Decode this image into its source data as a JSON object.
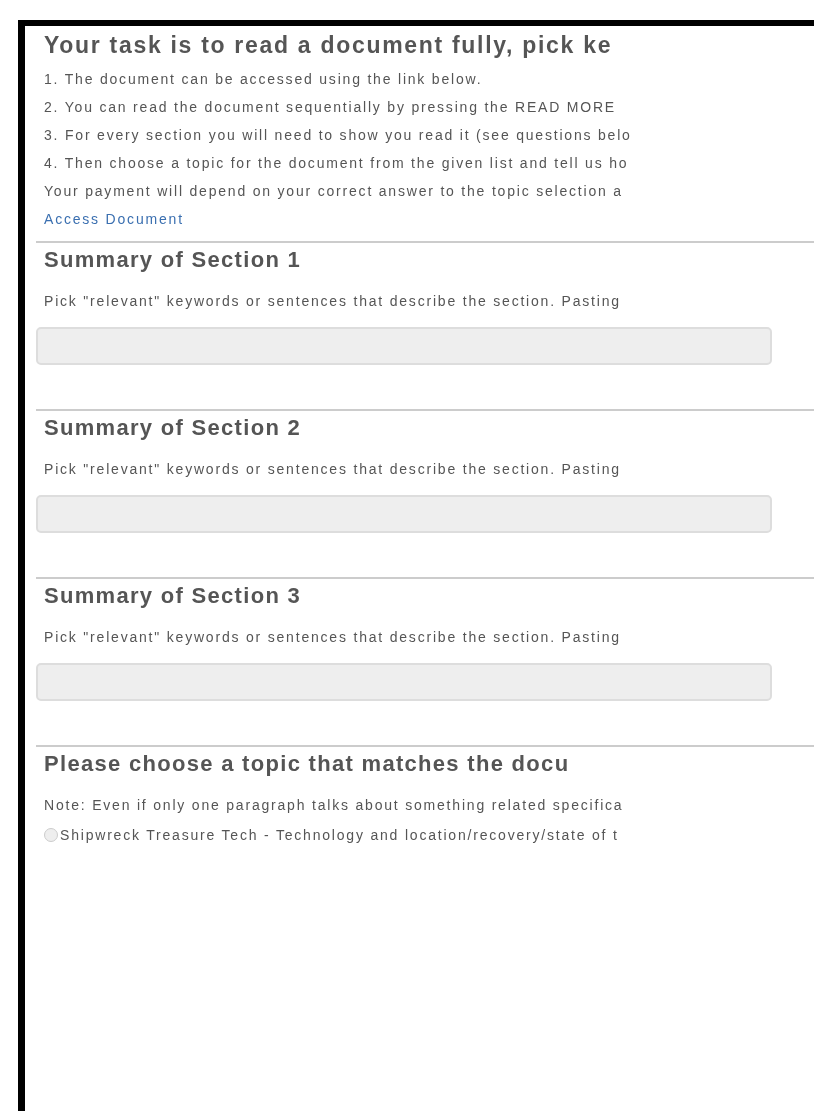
{
  "title": "Your task is to read a document fully, pick ke",
  "instructions": [
    "1. The document can be accessed using the link below.",
    "2. You can read the document sequentially by pressing the READ MORE",
    "3. For every section you will need to show you read it (see questions belo",
    "4. Then choose a topic for the document from the given list and tell us ho"
  ],
  "payment_note": "Your payment will depend on your correct answer to the topic selection a",
  "document_link": "Access Document",
  "sections": [
    {
      "heading": "Summary of Section 1",
      "description": "Pick \"relevant\" keywords or sentences that describe the section. Pasting"
    },
    {
      "heading": "Summary of Section 2",
      "description": "Pick \"relevant\" keywords or sentences that describe the section. Pasting"
    },
    {
      "heading": "Summary of Section 3",
      "description": "Pick \"relevant\" keywords or sentences that describe the section. Pasting"
    }
  ],
  "topic": {
    "heading": "Please choose a topic that matches the docu",
    "note": "Note: Even if only one paragraph talks about something related specifica",
    "options": [
      {
        "label": "Shipwreck Treasure Tech - Technology and location/recovery/state of t",
        "selected": false
      }
    ]
  }
}
